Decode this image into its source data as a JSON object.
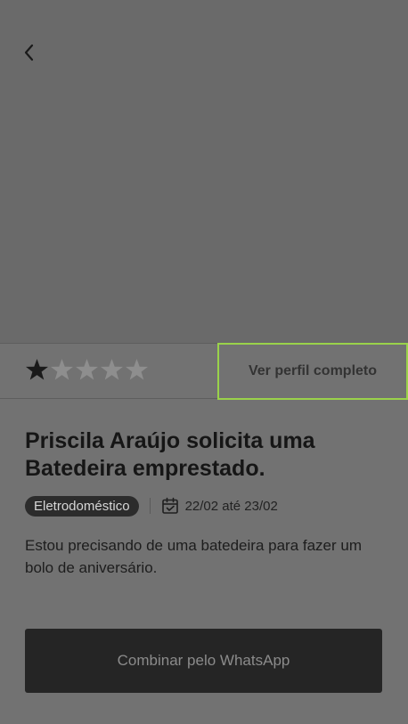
{
  "header": {
    "back_icon": "chevron-left-icon"
  },
  "rating": {
    "value": 1,
    "max": 5,
    "filled_color": "#1a1a1a",
    "empty_color": "#8e8e8e"
  },
  "profile": {
    "full_profile_label": "Ver perfil completo"
  },
  "request": {
    "title": "Priscila Araújo solicita uma Batedeira emprestado.",
    "category": "Eletrodoméstico",
    "dates": "22/02 até 23/02",
    "calendar_icon": "calendar-icon",
    "description": "Estou precisando de uma batedeira para fazer um bolo de aniversário."
  },
  "actions": {
    "whatsapp_label": "Combinar pelo WhatsApp"
  },
  "colors": {
    "highlight_border": "#9ad24a",
    "button_bg": "#252525",
    "badge_bg": "#2c2c2c"
  }
}
